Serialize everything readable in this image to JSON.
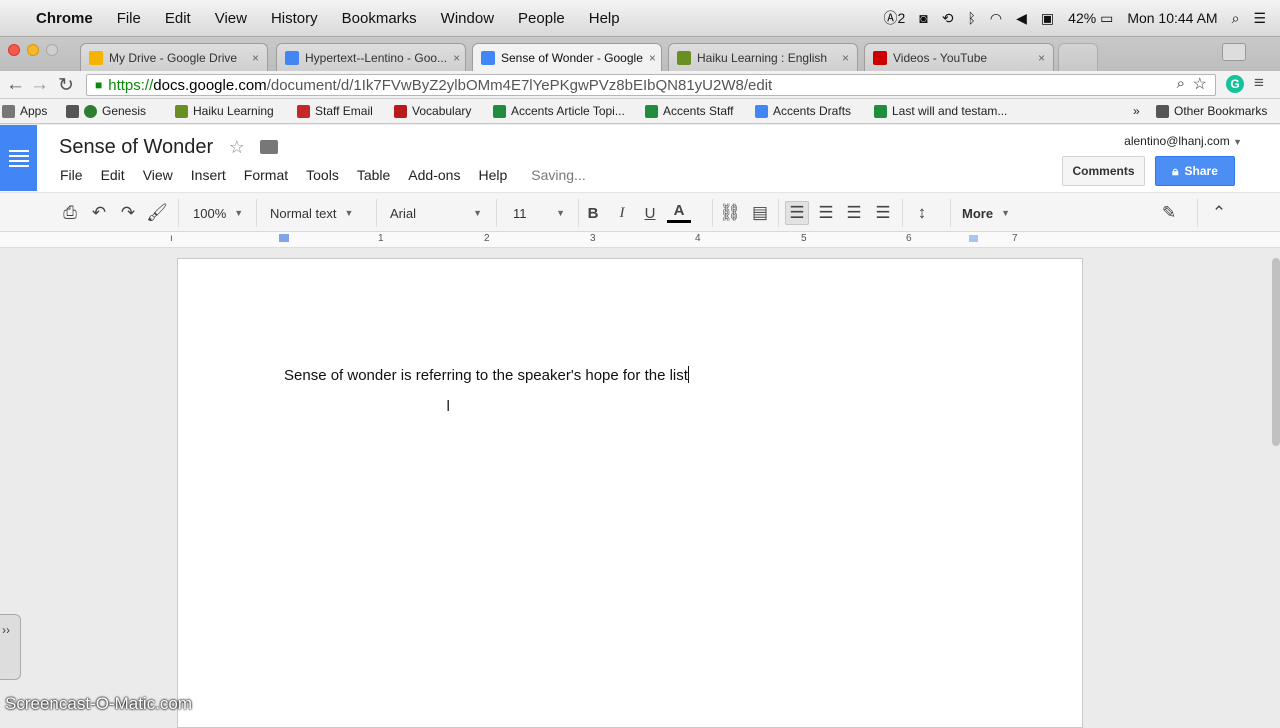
{
  "menubar": {
    "apple": "",
    "app": "Chrome",
    "items": [
      "File",
      "Edit",
      "View",
      "History",
      "Bookmarks",
      "Window",
      "People",
      "Help"
    ],
    "status": {
      "battery": "42%",
      "clock": "Mon 10:44 AM",
      "a2": "2"
    }
  },
  "tabs": [
    {
      "label": "My Drive - Google Drive",
      "color": "#f4b400"
    },
    {
      "label": "Hypertext--Lentino - Goo...",
      "color": "#4285f4"
    },
    {
      "label": "Sense of Wonder - Google",
      "color": "#4285f4"
    },
    {
      "label": "Haiku Learning : English",
      "color": "#6b8e23"
    },
    {
      "label": "Videos - YouTube",
      "color": "#cc0000"
    }
  ],
  "url": {
    "scheme": "https://",
    "host": "docs.google.com",
    "path": "/document/d/1Ik7FVwByZ2ylbOMm4E7lYePKgwPVz8bEIbQN81yU2W8/edit"
  },
  "bookmarks": [
    {
      "label": "Apps",
      "color": "#777"
    },
    {
      "label": "Genesis",
      "color": "#2e7d32"
    },
    {
      "label": "Haiku Learning",
      "color": "#6b8e23"
    },
    {
      "label": "Staff Email",
      "color": "#c62828"
    },
    {
      "label": "Vocabulary",
      "color": "#b71c1c"
    },
    {
      "label": "Accents Article Topi...",
      "color": "#1e8e3e"
    },
    {
      "label": "Accents Staff",
      "color": "#1e8e3e"
    },
    {
      "label": "Accents Drafts",
      "color": "#4285f4"
    },
    {
      "label": "Last will and testam...",
      "color": "#1e8e3e"
    }
  ],
  "bookmarks_more": "»",
  "bookmarks_other": "Other Bookmarks",
  "doc": {
    "title": "Sense of Wonder",
    "menu": [
      "File",
      "Edit",
      "View",
      "Insert",
      "Format",
      "Tools",
      "Table",
      "Add-ons",
      "Help"
    ],
    "status": "Saving...",
    "account": "alentino@lhanj.com",
    "comments": "Comments",
    "share": "Share"
  },
  "toolbar": {
    "zoom": "100%",
    "style": "Normal text",
    "font": "Arial",
    "size": "11",
    "more": "More"
  },
  "ruler": [
    "1",
    "1",
    "2",
    "3",
    "4",
    "5",
    "6",
    "7"
  ],
  "body_text": "Sense of wonder is referring to the speaker's hope for the list",
  "watermark": "Screencast-O-Matic.com"
}
